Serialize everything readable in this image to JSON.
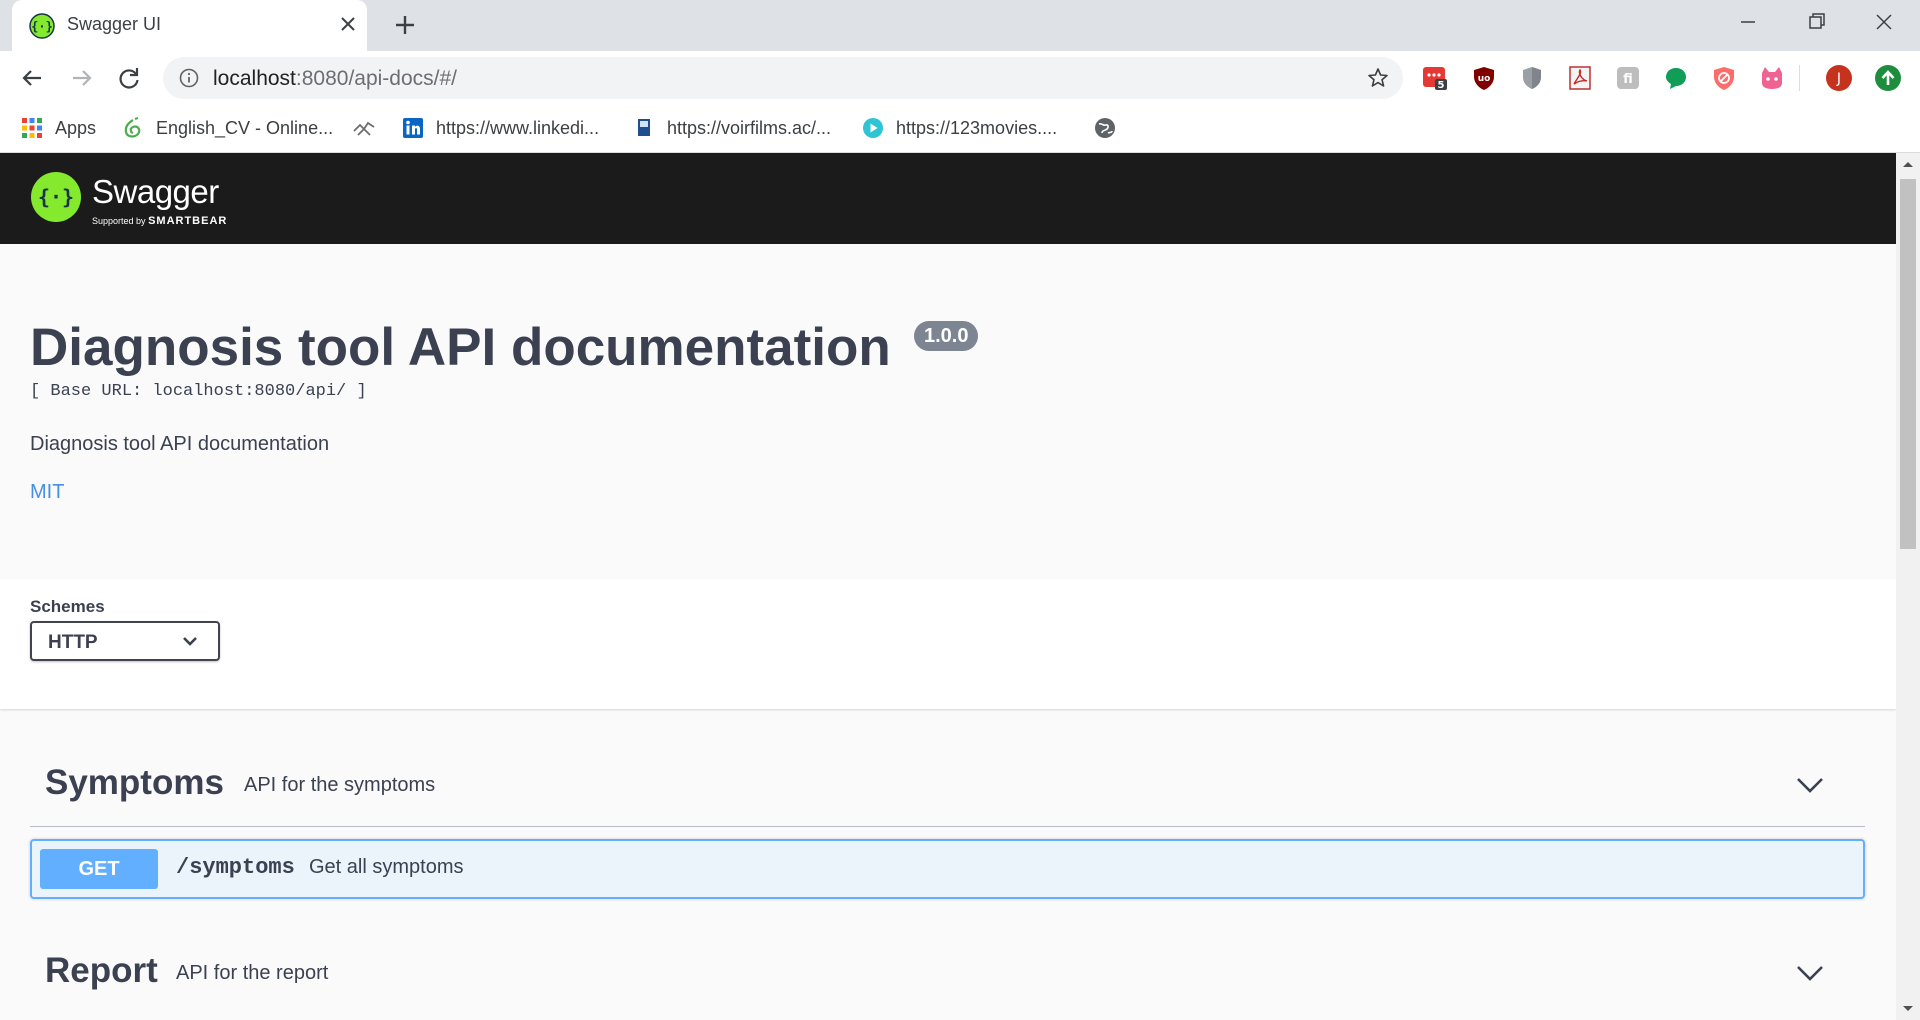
{
  "browser": {
    "tab_title": "Swagger UI",
    "url_host": "localhost",
    "url_rest": ":8080/api-docs/#/",
    "extension_badge": "5",
    "profile_initial": "J",
    "bookmarks": [
      {
        "label": "Apps",
        "icon": "apps-grid-icon"
      },
      {
        "label": "English_CV - Online...",
        "icon": "overleaf-icon"
      },
      {
        "label": "",
        "icon": "bird-icon"
      },
      {
        "label": "https://www.linkedi...",
        "icon": "linkedin-icon"
      },
      {
        "label": "https://voirfilms.ac/...",
        "icon": "voirfilms-icon"
      },
      {
        "label": "https://123movies....",
        "icon": "play-icon"
      },
      {
        "label": "",
        "icon": "globe-icon"
      }
    ]
  },
  "swagger": {
    "logo_text": "Swagger",
    "logo_sub_prefix": "Supported by",
    "logo_sub_brand": "SMARTBEAR",
    "title": "Diagnosis tool API documentation",
    "version": "1.0.0",
    "base_url": "[ Base URL: localhost:8080/api/ ]",
    "description": "Diagnosis tool API documentation",
    "license": "MIT",
    "schemes_label": "Schemes",
    "schemes_value": "HTTP",
    "tags": [
      {
        "name": "Symptoms",
        "description": "API for the symptoms",
        "operations": [
          {
            "method": "GET",
            "path": "/symptoms",
            "summary": "Get all symptoms"
          }
        ]
      },
      {
        "name": "Report",
        "description": "API for the report"
      }
    ]
  },
  "colors": {
    "topbar": "#1b1b1b",
    "swagger_green": "#85ea2d",
    "get_blue": "#61affe",
    "get_bg": "#ebf3fb",
    "link": "#4990e2",
    "text": "#3b4151",
    "badge": "#7d8492"
  }
}
